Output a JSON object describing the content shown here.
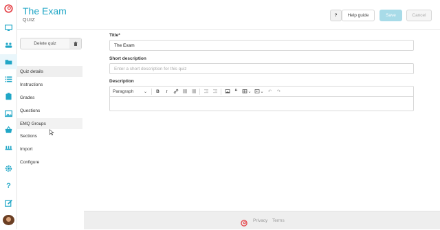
{
  "app": {
    "page_title": "The Exam",
    "page_type": "QUIZ"
  },
  "header": {
    "help_icon_label": "?",
    "help_guide_label": "Help guide",
    "save_label": "Save",
    "cancel_label": "Cancel",
    "save_color": "#a8dbe8",
    "accent": "#1fa6c6"
  },
  "sidebar": {
    "delete_label": "Delete quiz",
    "items": [
      {
        "label": "Quiz details",
        "selected": true
      },
      {
        "label": "Instructions"
      },
      {
        "label": "Grades"
      },
      {
        "label": "Questions"
      },
      {
        "label": "EMQ Groups",
        "hover": true
      },
      {
        "label": "Sections"
      },
      {
        "label": "Import"
      },
      {
        "label": "Configure"
      }
    ]
  },
  "rail": {
    "icons": [
      "logo-icon",
      "monitor-icon",
      "users-icon",
      "folder-icon",
      "list-icon",
      "clipboard-icon",
      "image-icon",
      "basket-icon",
      "bank-icon",
      "gear-icon",
      "help-icon",
      "edit-icon",
      "avatar"
    ]
  },
  "form": {
    "title_label": "Title*",
    "title_value": "The Exam",
    "short_label": "Short description",
    "short_placeholder": "Enter a short description for this quiz",
    "desc_label": "Description",
    "paragraph_label": "Paragraph",
    "toolbar_icons": [
      "bold-icon",
      "italic-icon",
      "link-icon",
      "bullet-list-icon",
      "numbered-list-icon",
      "outdent-icon",
      "indent-icon",
      "image-icon",
      "quote-icon",
      "table-icon",
      "media-icon",
      "undo-icon",
      "redo-icon"
    ]
  },
  "footer": {
    "privacy": "Privacy",
    "terms": "Terms"
  }
}
